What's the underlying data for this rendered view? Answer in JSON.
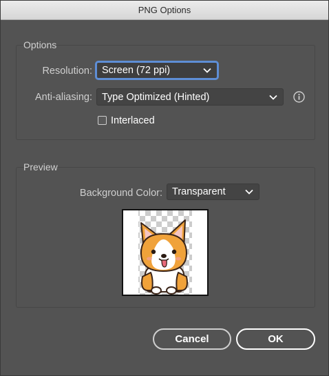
{
  "window": {
    "title": "PNG Options"
  },
  "options": {
    "group_label": "Options",
    "resolution": {
      "label": "Resolution:",
      "value": "Screen (72 ppi)"
    },
    "anti_aliasing": {
      "label": "Anti-aliasing:",
      "value": "Type Optimized (Hinted)"
    },
    "interlaced": {
      "label": "Interlaced",
      "checked": false
    }
  },
  "preview": {
    "group_label": "Preview",
    "background_color": {
      "label": "Background Color:",
      "value": "Transparent"
    }
  },
  "buttons": {
    "cancel": "Cancel",
    "ok": "OK"
  },
  "icons": {
    "info": "info-icon",
    "chevron": "chevron-down-icon"
  },
  "colors": {
    "dialog_bg": "#535353",
    "focus_ring": "#5e8ed6",
    "corgi_orange": "#f0a23a"
  }
}
